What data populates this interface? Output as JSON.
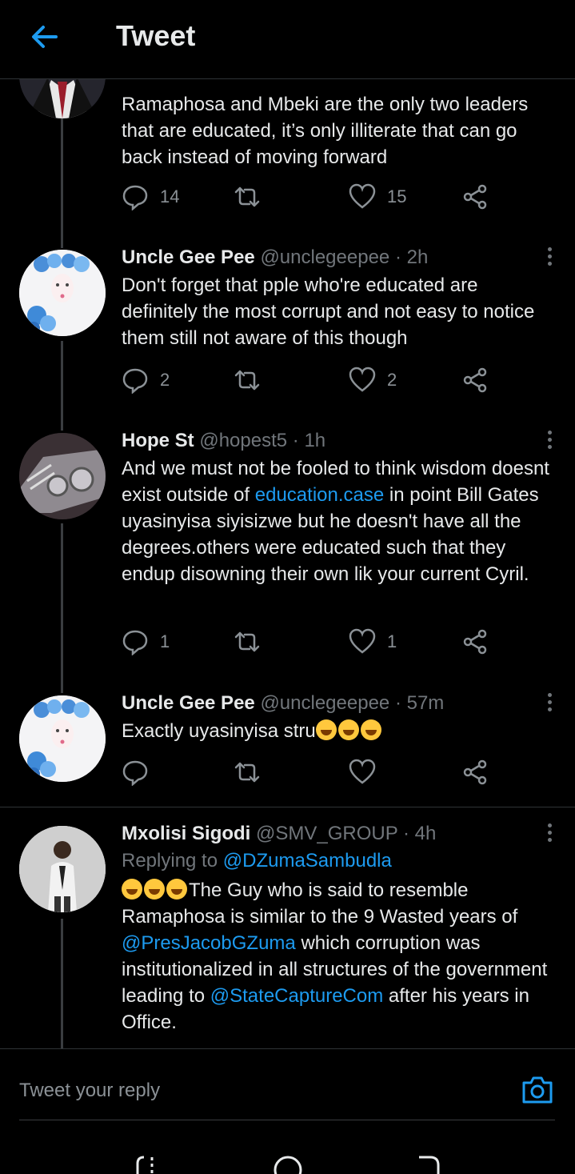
{
  "header": {
    "title": "Tweet"
  },
  "first_tweet": {
    "text": "Ramaphosa and Mbeki are the only two leaders that are educated, it’s only illiterate that can go back instead of moving forward",
    "replies": "14",
    "likes": "15"
  },
  "tweets": [
    {
      "name": "Uncle Gee Pee",
      "handle": "@unclegeepee",
      "time": "· 2h",
      "text": "Don't forget that pple who're educated are definitely the most corrupt and not easy to notice them still not aware of this though",
      "replies": "2",
      "likes": "2"
    },
    {
      "name": "Hope St",
      "handle": "@hopest5",
      "time": "· 1h",
      "text_a": "And we must not be fooled to think wisdom doesnt exist outside of ",
      "link": "education.case",
      "text_b": " in point Bill Gates uyasinyisa siyisizwe but he doesn't have all the degrees.others were educated such that they endup disowning their own lik your current Cyril.",
      "replies": "1",
      "likes": "1"
    },
    {
      "name": "Uncle Gee Pee",
      "handle": "@unclegeepee",
      "time": "· 57m",
      "text": "Exactly uyasinyisa stru"
    },
    {
      "name": "Mxolisi Sigodi",
      "handle": "@SMV_GROUP",
      "time": "· 4h",
      "replying_label": "Replying to ",
      "replying_to": "@DZumaSambudla",
      "text_a": "The Guy who is said to resemble Ramaphosa is similar to the 9 Wasted years of ",
      "mention1": "@PresJacobGZuma",
      "text_b": " which corruption was institutionalized in all structures of the government leading to ",
      "mention2": "@StateCaptureCom",
      "text_c": " after his years in Office."
    }
  ],
  "reply_bar": {
    "placeholder": "Tweet your reply"
  },
  "icons": {
    "back": "back-arrow-icon",
    "reply": "reply-icon",
    "retweet": "retweet-icon",
    "like": "heart-icon",
    "share": "share-icon",
    "more": "more-options-icon",
    "camera": "camera-icon",
    "emoji": "rolling-laughing-emoji"
  },
  "colors": {
    "accent": "#1d9bf0",
    "background": "#000000",
    "text": "#e7e9ea",
    "muted": "#71767b"
  }
}
